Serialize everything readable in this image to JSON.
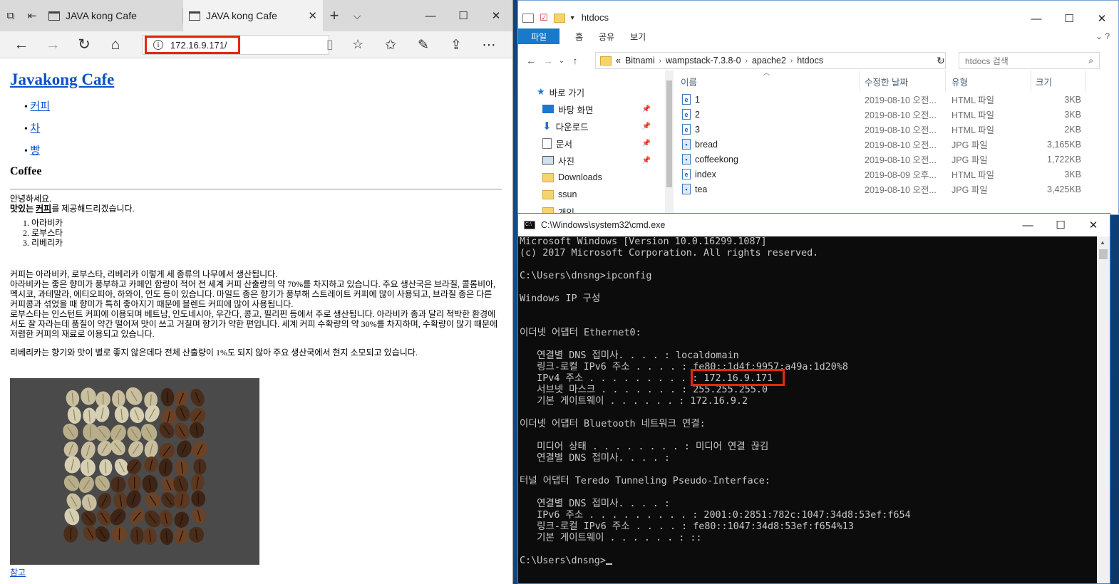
{
  "browser": {
    "tabs": [
      {
        "label": "JAVA kong Cafe"
      },
      {
        "label": "JAVA kong Cafe"
      }
    ],
    "address": "172.16.9.171/",
    "page": {
      "title": "Javakong Cafe",
      "nav": [
        "커피",
        "차",
        "빵"
      ],
      "section_heading": "Coffee",
      "greeting": "안녕하세요.",
      "intro_bold": "맛있는",
      "intro_link": "커피",
      "intro_rest": "를 제공해드리겠습니다.",
      "varieties": [
        "아라비카",
        "로부스타",
        "리베리카"
      ],
      "paragraph1": "커피는 아라비카, 로부스타, 리베리카 이렇게 세 종류의 나무에서 생산됩니다.\n아라비카는 좋은 향미가 풍부하고 카페인 함량이 적어 전 세계 커피 산출량의 약 70%를 차지하고 있습니다. 주요 생산국은 브라질, 콜롬비아, 멕시코, 과테말라, 에티오피아, 하와이, 인도 등이 있습니다. 마일드 종은 향기가 풍부해 스트레이트 커피에 많이 사용되고, 브라질 종은 다른 커피콩과 섞었을 때 향미가 특히 좋아지기 때문에 블렌드 커피에 많이 사용됩니다.\n로부스타는 인스턴트 커피에 이용되며 베트남, 인도네시아, 우간다, 콩고, 필리핀 등에서 주로 생산됩니다. 아라비카 종과 달리 척박한 환경에서도 잘 자라는데 품질이 약간 떨어져 맛이 쓰고 거칠며 향기가 약한 편입니다. 세계 커피 수확량의 약 30%를 차지하며, 수확량이 많기 때문에 저렴한 커피의 재료로 이용되고 있습니다.",
      "paragraph2": "리베리카는 향기와 맛이 별로 좋지 않은데다 전체 산출량이 1%도 되지 않아 주요 생산국에서 현지 소모되고 있습니다.",
      "reference_link": "참고"
    }
  },
  "explorer": {
    "title": "htdocs",
    "ribbon": {
      "file": "파일",
      "tabs": [
        "홈",
        "공유",
        "보기"
      ]
    },
    "path": [
      "«",
      "Bitnami",
      "wampstack-7.3.8-0",
      "apache2",
      "htdocs"
    ],
    "search_placeholder": "htdocs 검색",
    "sidebar": {
      "quick_access": "바로 가기",
      "items": [
        "바탕 화면",
        "다운로드",
        "문서",
        "사진",
        "Downloads",
        "ssun",
        "개인"
      ]
    },
    "columns": {
      "name": "이름",
      "date": "수정한 날짜",
      "type": "유형",
      "size": "크기"
    },
    "files": [
      {
        "name": "1",
        "date": "2019-08-10 오전...",
        "type": "HTML 파일",
        "size": "3KB",
        "icon": "html"
      },
      {
        "name": "2",
        "date": "2019-08-10 오전...",
        "type": "HTML 파일",
        "size": "3KB",
        "icon": "html"
      },
      {
        "name": "3",
        "date": "2019-08-10 오전...",
        "type": "HTML 파일",
        "size": "2KB",
        "icon": "html"
      },
      {
        "name": "bread",
        "date": "2019-08-10 오전...",
        "type": "JPG 파일",
        "size": "3,165KB",
        "icon": "jpg"
      },
      {
        "name": "coffeekong",
        "date": "2019-08-10 오전...",
        "type": "JPG 파일",
        "size": "1,722KB",
        "icon": "jpg"
      },
      {
        "name": "index",
        "date": "2019-08-09 오후...",
        "type": "HTML 파일",
        "size": "3KB",
        "icon": "html"
      },
      {
        "name": "tea",
        "date": "2019-08-10 오전...",
        "type": "JPG 파일",
        "size": "3,425KB",
        "icon": "jpg"
      }
    ]
  },
  "cmd": {
    "title": "C:\\Windows\\system32\\cmd.exe",
    "lines": [
      "Microsoft Windows [Version 10.0.16299.1087]",
      "(c) 2017 Microsoft Corporation. All rights reserved.",
      "",
      "C:\\Users\\dnsng>ipconfig",
      "",
      "Windows IP 구성",
      "",
      "",
      "이더넷 어댑터 Ethernet0:",
      "",
      "   연결별 DNS 접미사. . . . : localdomain",
      "   링크-로컬 IPv6 주소 . . . . : fe80::1d4f:9957:a49a:1d20%8",
      "   IPv4 주소 . . . . . . . . . : 172.16.9.171",
      "   서브넷 마스크 . . . . . . . : 255.255.255.0",
      "   기본 게이트웨이 . . . . . . : 172.16.9.2",
      "",
      "이더넷 어댑터 Bluetooth 네트워크 연결:",
      "",
      "   미디어 상태 . . . . . . . . : 미디어 연결 끊김",
      "   연결별 DNS 접미사. . . . :",
      "",
      "터널 어댑터 Teredo Tunneling Pseudo-Interface:",
      "",
      "   연결별 DNS 접미사. . . . :",
      "   IPv6 주소 . . . . . . . . . : 2001:0:2851:782c:1047:34d8:53ef:f654",
      "   링크-로컬 IPv6 주소 . . . . : fe80::1047:34d8:53ef:f654%13",
      "   기본 게이트웨이 . . . . . . : ::",
      "",
      "C:\\Users\\dnsng>"
    ]
  }
}
